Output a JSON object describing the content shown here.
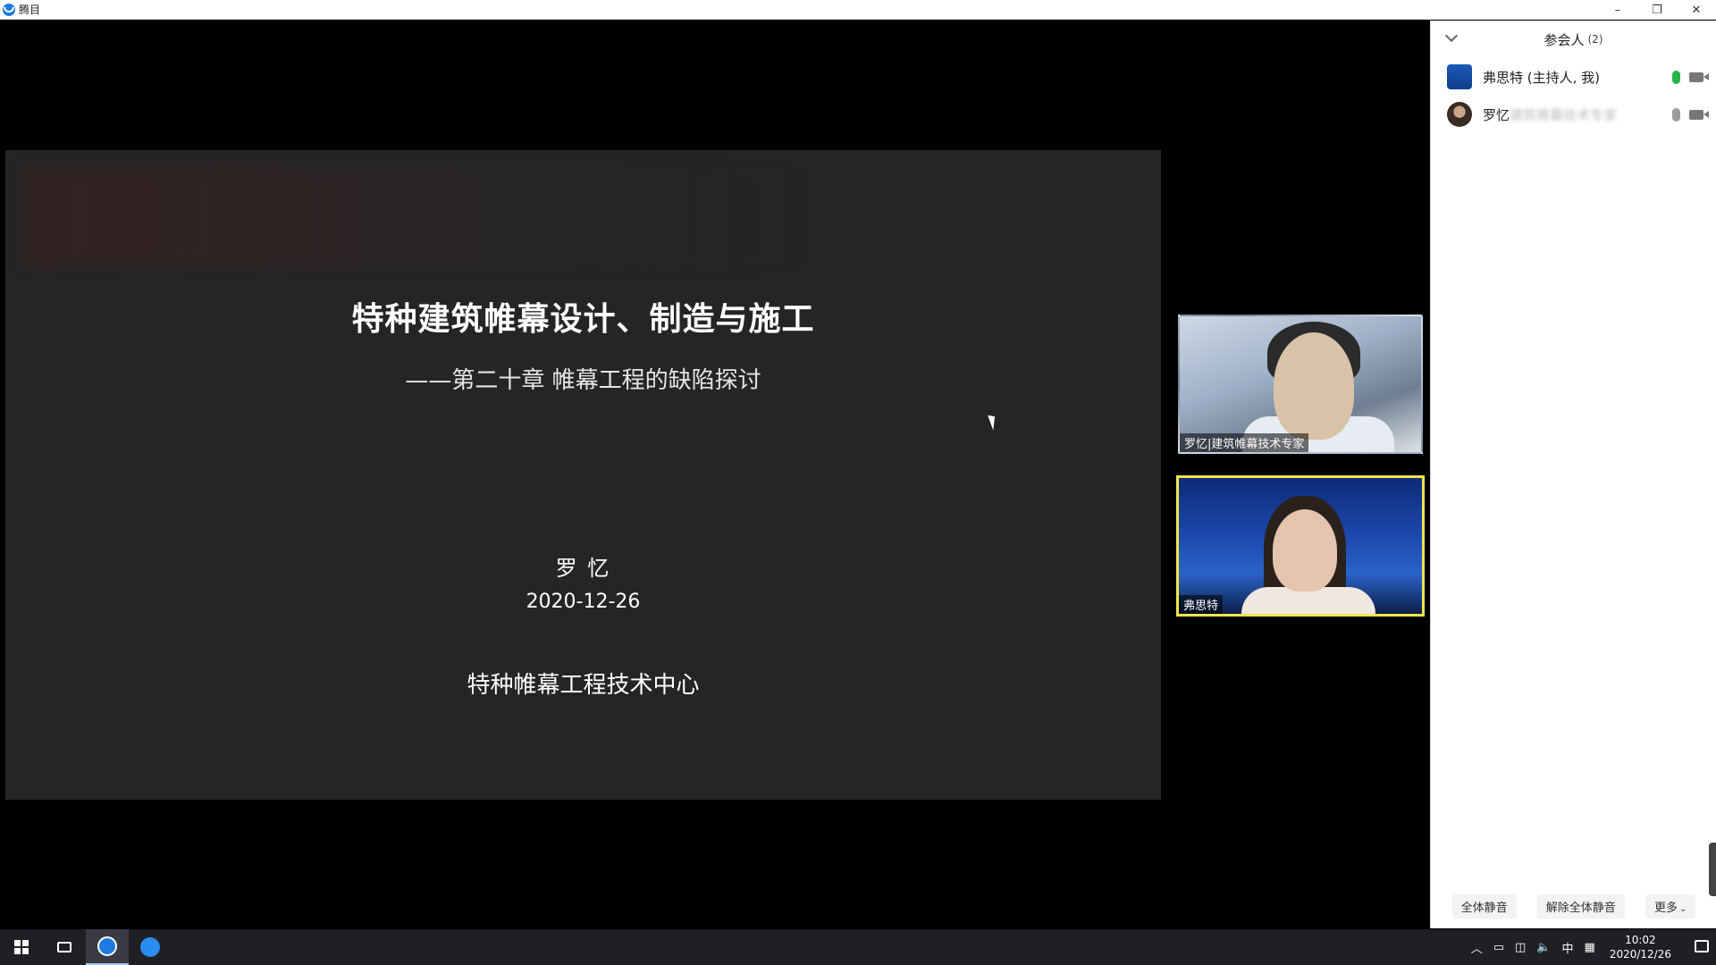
{
  "window": {
    "app_title": "腾目",
    "minimize": "–",
    "restore": "❐",
    "close": "✕"
  },
  "slide": {
    "title": "特种建筑帷幕设计、制造与施工",
    "subtitle": "——第二十章   帷幕工程的缺陷探讨",
    "author": "罗  忆",
    "date": "2020-12-26",
    "organization": "特种帷幕工程技术中心"
  },
  "video_tiles": [
    {
      "label": "罗忆|建筑帷幕技术专家"
    },
    {
      "label": "弗思特"
    }
  ],
  "participants_panel": {
    "title": "参会人",
    "count": "(2)",
    "participants": [
      {
        "name": "弗思特 (主持人, 我)",
        "mic": "on",
        "camera": "on"
      },
      {
        "name_visible": "罗忆",
        "name_blurred": "建筑帷幕技术专家",
        "mic": "off",
        "camera": "on"
      }
    ],
    "buttons": {
      "mute_all": "全体静音",
      "unmute_all": "解除全体静音",
      "more": "更多"
    }
  },
  "taskbar": {
    "ime": "中",
    "time": "10:02",
    "date": "2020/12/26"
  },
  "colors": {
    "accent_blue": "#1f7ae0",
    "active_speaker_border": "#f2e64a",
    "mic_on": "#26b34a",
    "slide_bg": "#252525"
  }
}
